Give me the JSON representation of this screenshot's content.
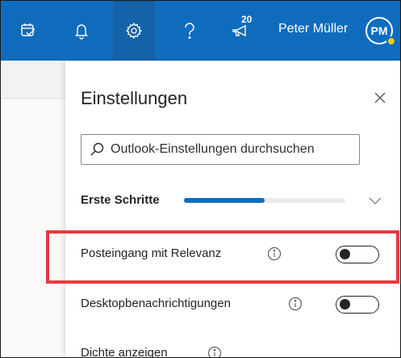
{
  "topbar": {
    "icons": [
      "my-day-icon",
      "bell-icon",
      "gear-icon",
      "help-icon",
      "megaphone-icon"
    ],
    "notification_count": "20",
    "user_name": "Peter Müller",
    "avatar_initials": "PM",
    "accent": "#0f6cbd",
    "presence_color": "#f2c811"
  },
  "settings": {
    "title": "Einstellungen",
    "search_placeholder": "Outlook-Einstellungen durchsuchen",
    "getting_started_label": "Erste Schritte",
    "getting_started_progress": 0.5,
    "focused_inbox_label": "Posteingang mit Relevanz",
    "focused_inbox_enabled": false,
    "desktop_notifications_label": "Desktopbenachrichtigungen",
    "desktop_notifications_enabled": false,
    "density_label": "Dichte anzeigen"
  },
  "highlight_color": "#e83a3f"
}
